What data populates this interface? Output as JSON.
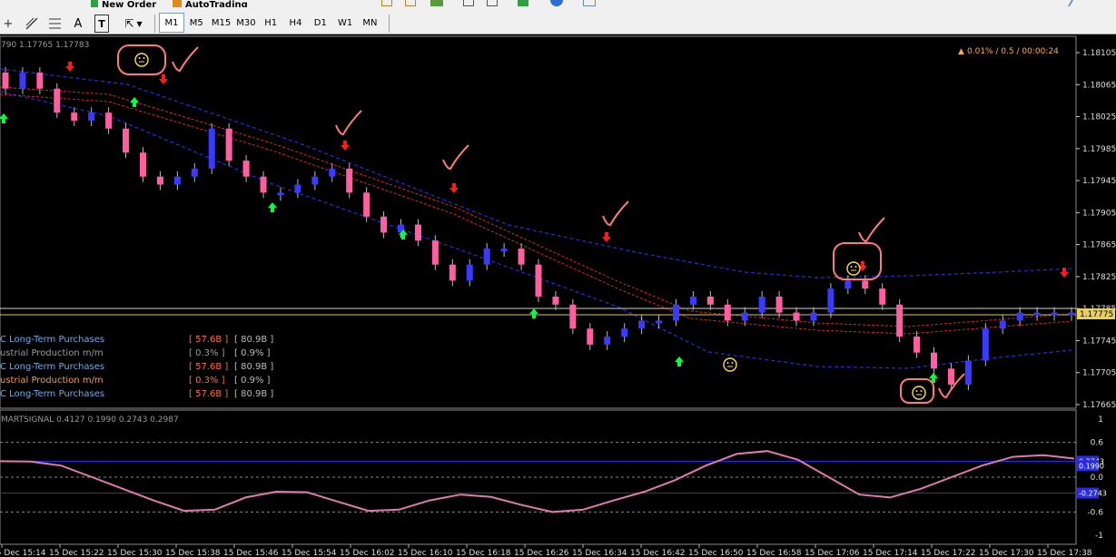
{
  "toolbar": {
    "top_buttons": [
      "New Order",
      "AutoTrading"
    ],
    "text_tool": "A",
    "label_tool": "T",
    "timeframes": [
      "M1",
      "M5",
      "M15",
      "M30",
      "H1",
      "H4",
      "D1",
      "W1",
      "MN"
    ],
    "active_timeframe": "M1",
    "colors": {
      "green": "#2ea043",
      "orange": "#e08a1e",
      "blue": "#2a6fd6"
    }
  },
  "chart": {
    "header": "790 1.17765 1.17783",
    "status": "0.01% / 0.5 / 00:00:24",
    "status_marker": "▲",
    "current_price": "1.17775",
    "price_ticks": [
      "1.18105",
      "1.18065",
      "1.18025",
      "1.17985",
      "1.17945",
      "1.17905",
      "1.17865",
      "1.17825",
      "1.17785",
      "1.17745",
      "1.17705",
      "1.17665"
    ],
    "news": [
      {
        "name": "C Long-Term Purchases",
        "v1": "[ 57.6B ]",
        "v2": "[ 80.9B ]",
        "color": "#6aaee8",
        "v1color": "#ff6a3a"
      },
      {
        "name": "ustrial Production m/m",
        "v1": "[ 0.3% ]",
        "v2": "[ 0.9% ]",
        "color": "#9a9a9a",
        "v1color": "#9a9a9a"
      },
      {
        "name": "C Long-Term Purchases",
        "v1": "[ 57.6B ]",
        "v2": "[ 80.9B ]",
        "color": "#6aaee8",
        "v1color": "#ff6a3a"
      },
      {
        "name": "ustrial Production m/m",
        "v1": "[ 0.3% ]",
        "v2": "[ 0.9% ]",
        "color": "#ff9a3a",
        "v1color": "#ff6a3a"
      },
      {
        "name": "C Long-Term Purchases",
        "v1": "[ 57.6B ]",
        "v2": "[ 80.9B ]",
        "color": "#6aaee8",
        "v1color": "#ff6a3a"
      }
    ],
    "time_labels": [
      "15 Dec 15:14",
      "15 Dec 15:22",
      "15 Dec 15:30",
      "15 Dec 15:38",
      "15 Dec 15:46",
      "15 Dec 15:54",
      "15 Dec 16:02",
      "15 Dec 16:10",
      "15 Dec 16:18",
      "15 Dec 16:26",
      "15 Dec 16:34",
      "15 Dec 16:42",
      "15 Dec 16:50",
      "15 Dec 16:58",
      "15 Dec 17:06",
      "15 Dec 17:14",
      "15 Dec 17:22",
      "15 Dec 17:30",
      "15 Dec 17:38"
    ],
    "colors": {
      "bull": "#3a3aff",
      "bear": "#ff5fa0",
      "band": "#2a2ae0",
      "mid": "#e0202a",
      "up_arrow": "#00ff3c",
      "down_arrow": "#ff1a1a",
      "annotation": "#ff7a7a",
      "price_line": "#e0c070",
      "osc": "#e07ab0"
    }
  },
  "indicator": {
    "title": "MARTSIGNAL 0.4127 0.1990 0.2743 0.2987",
    "ticks": [
      "1",
      "0.6",
      "0.0",
      "-0.6",
      "-1"
    ],
    "highlighted": [
      "0.2743",
      "0.1990",
      "-0.2743"
    ],
    "highlight_color": "#2a2ae0"
  },
  "chart_data": {
    "type": "line",
    "series": [
      {
        "values": [
          1.1806,
          1.1808,
          1.1806,
          1.1803,
          1.1802,
          1.1803,
          1.1801,
          1.1798,
          1.1795,
          1.1794,
          1.1795,
          1.1796,
          1.1801,
          1.1797,
          1.1795,
          1.1793,
          1.1793,
          1.1794,
          1.1795,
          1.1796,
          1.1793,
          1.179,
          1.1788,
          1.1789,
          1.1787,
          1.1784,
          1.1782,
          1.1784,
          1.1786,
          1.1786,
          1.1784,
          1.178,
          1.1779,
          1.1776,
          1.1774,
          1.1775,
          1.1776,
          1.1777,
          1.1777,
          1.1779,
          1.178,
          1.1779,
          1.1777,
          1.1778,
          1.178,
          1.1778,
          1.1777,
          1.1778,
          1.1781,
          1.1782,
          1.1781,
          1.1779,
          1.1775,
          1.1773,
          1.1771,
          1.1769,
          1.1772,
          1.1776,
          1.1777,
          1.1778,
          1.1778,
          1.1778,
          1.1778
        ]
      }
    ],
    "ylim": [
      1.1765,
      1.1812
    ]
  },
  "oscillator_data": {
    "type": "line",
    "series": [
      {
        "values": [
          0.2743,
          0.27,
          0.199,
          0.0,
          -0.2,
          -0.4,
          -0.58,
          -0.56,
          -0.35,
          -0.25,
          -0.26,
          -0.42,
          -0.58,
          -0.56,
          -0.4,
          -0.3,
          -0.34,
          -0.48,
          -0.6,
          -0.56,
          -0.4,
          -0.25,
          -0.05,
          0.2,
          0.4,
          0.45,
          0.3,
          0.0,
          -0.3,
          -0.35,
          -0.2,
          0.0,
          0.2,
          0.35,
          0.38,
          0.32
        ]
      }
    ],
    "ylim": [
      -1,
      1
    ]
  }
}
